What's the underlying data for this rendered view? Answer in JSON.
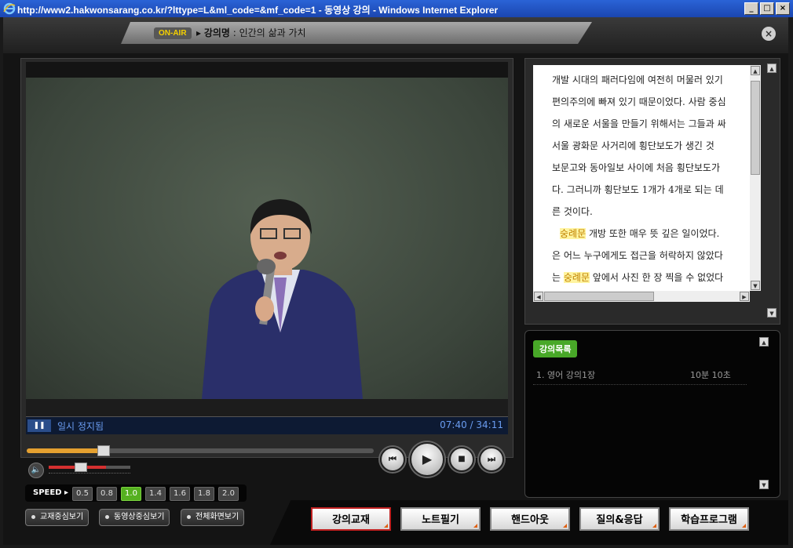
{
  "window": {
    "title": "http://www2.hakwonsarang.co.kr/?lttype=L&ml_code=&mf_code=1 - 동영상 강의 - Windows Internet Explorer",
    "min": "_",
    "max": "□",
    "close": "×"
  },
  "header": {
    "badge": "ON-AIR",
    "title_label": "강의명",
    "title_text": " : 인간의 삶과 가치",
    "close": "×"
  },
  "player": {
    "status_icon": "❚❚",
    "status_text": "일시 정지됨",
    "time": "07:40 / 34:11",
    "progress": 0.22,
    "volume": 0.7,
    "vol_icon": "🔈",
    "buttons": {
      "prev": "⏮",
      "play": "▶",
      "stop": "■",
      "next": "⏭"
    }
  },
  "speed": {
    "label": "SPEED ▸",
    "options": [
      "0.5",
      "0.8",
      "1.0",
      "1.4",
      "1.6",
      "1.8",
      "2.0"
    ],
    "selected": "1.0"
  },
  "view_modes": [
    "교재중심보기",
    "동영상중심보기",
    "전체화면보기"
  ],
  "tabs": [
    "강의교재",
    "노트필기",
    "핸드아웃",
    "질의&응답",
    "학습프로그램"
  ],
  "active_tab": "강의교재",
  "textbook": {
    "lines": [
      "개발 시대의 패러다임에 여전히 머물러 있기",
      "편의주의에 빠져 있기 때문이었다. 사람 중심",
      "의 새로운 서울을 만들기 위해서는 그들과 싸",
      "  서울 광화문 사거리에 횡단보도가 생긴 것",
      "보문고와 동아일보 사이에 처음 횡단보도가",
      "다. 그러니까 횡단보도 1개가 4개로 되는 데",
      "른 것이다."
    ],
    "line_hl1": {
      "hl": "숭례문",
      "rest": " 개방 또한 매우 뜻 깊은 일이었다."
    },
    "line_plain": "은 어느 누구에게도 접근을 허락하지 않았다",
    "line_hl2": {
      "pre": "는 ",
      "hl": "숭례문",
      "rest": " 앞에서 사진 한 장 찍을 수 없었다"
    }
  },
  "lecture_list": {
    "tab": "강의목록",
    "items": [
      {
        "title": "1. 영어 강의1장",
        "duration": "10분 10초"
      }
    ]
  }
}
